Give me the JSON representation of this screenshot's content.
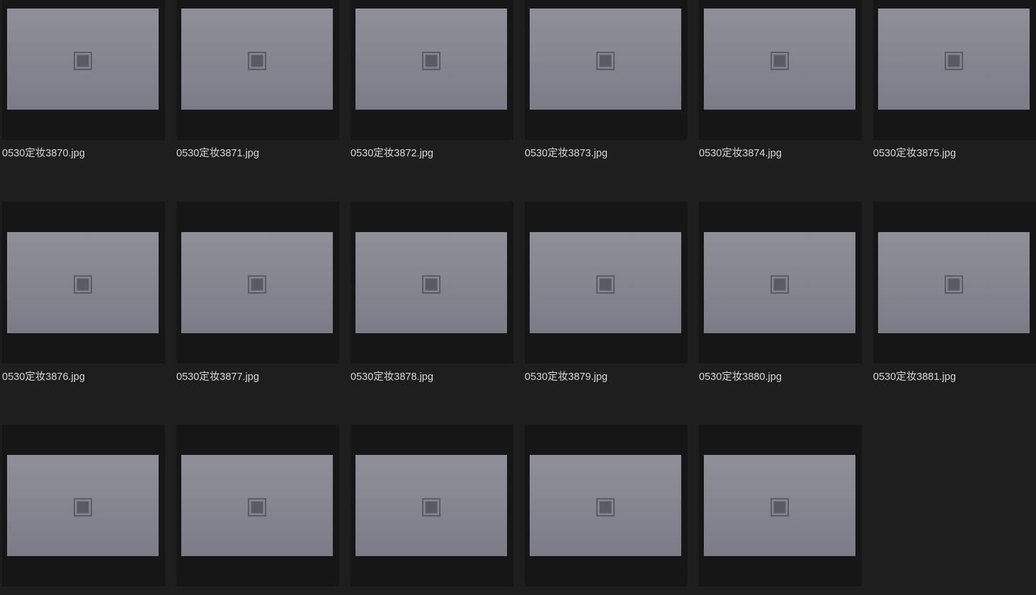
{
  "files": [
    {
      "name": "0530定妆3870.jpg"
    },
    {
      "name": "0530定妆3871.jpg"
    },
    {
      "name": "0530定妆3872.jpg"
    },
    {
      "name": "0530定妆3873.jpg"
    },
    {
      "name": "0530定妆3874.jpg"
    },
    {
      "name": "0530定妆3875.jpg"
    },
    {
      "name": "0530定妆3876.jpg"
    },
    {
      "name": "0530定妆3877.jpg"
    },
    {
      "name": "0530定妆3878.jpg"
    },
    {
      "name": "0530定妆3879.jpg"
    },
    {
      "name": "0530定妆3880.jpg"
    },
    {
      "name": "0530定妆3881.jpg"
    },
    {
      "name": ""
    },
    {
      "name": ""
    },
    {
      "name": ""
    },
    {
      "name": ""
    },
    {
      "name": ""
    }
  ],
  "thumbnail_icon": "image-placeholder-icon"
}
